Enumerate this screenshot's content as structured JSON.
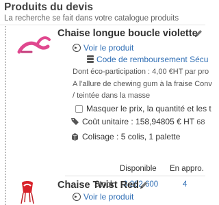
{
  "panel": {
    "title": "Produits du devis",
    "subtitle": "La recherche se fait dans votre catalogue produits"
  },
  "products": [
    {
      "title": "Chaise longue boucle violette",
      "view_link": "Voir le produit",
      "refund_code_link": "Code de remboursement Sécu",
      "eco_participation": "Dont éco-participation : 4,00 €HT par pro",
      "description_1": "A l'allure de chewing gum à la fraise Conv",
      "description_2": "/ teintée dans la masse",
      "hide_option_label": "Masquer le prix, la quantité et les t",
      "unit_cost_label": "Coût unitaire : 158,94805 € HT",
      "unit_cost_extra": "68",
      "packaging_label": "Colisage : 5 colis, 1 palette",
      "stock": {
        "col_available": "Disponible",
        "col_on_order": "En appro.",
        "row_label": "Stock",
        "available_value": "3 262 600",
        "on_order_value": "4"
      },
      "accent_color": "#e0488f"
    },
    {
      "title": "Chaise Twist Red",
      "view_link": "Voir le produit",
      "accent_color": "#d8222a"
    }
  ],
  "colors": {
    "link": "#2f6eb5",
    "text": "#333333",
    "muted": "#555555"
  },
  "icons": [
    "edit-icon",
    "arrow-circle-icon",
    "coins-icon",
    "tag-icon",
    "box-icon",
    "checkbox"
  ]
}
